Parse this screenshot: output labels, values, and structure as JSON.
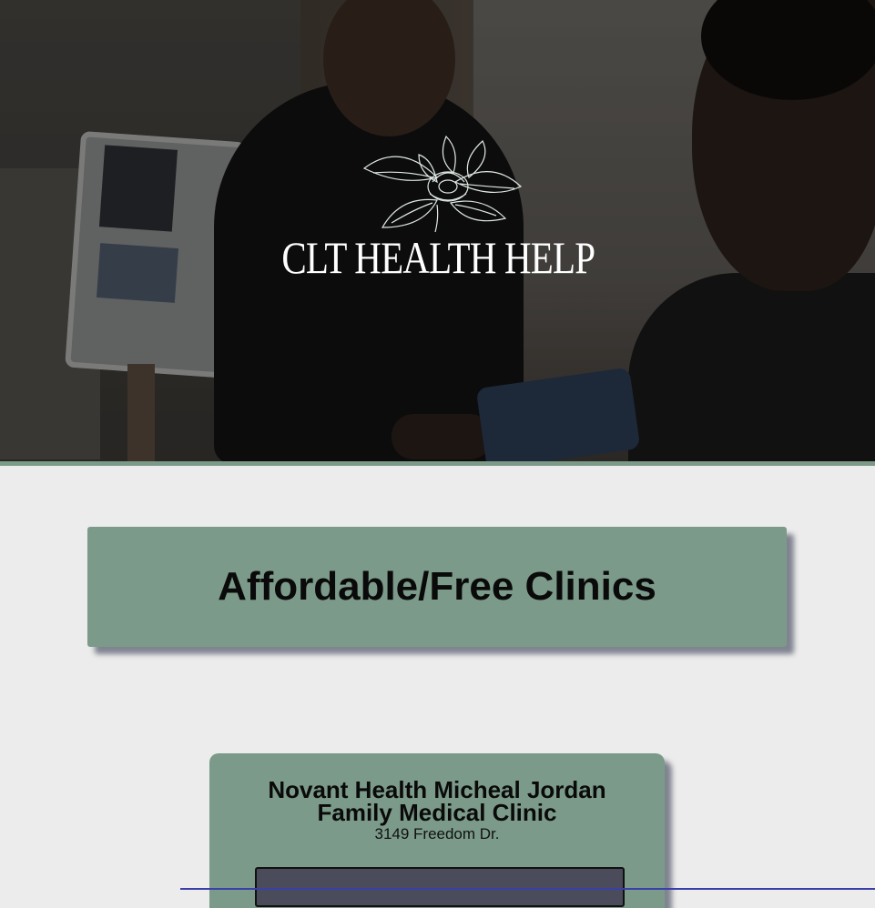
{
  "hero": {
    "brand": "CLT HEALTH HELP",
    "logo_icon": "magnolia-flower-icon"
  },
  "section": {
    "heading": "Affordable/Free Clinics"
  },
  "clinics": [
    {
      "name": "Novant Health Micheal Jordan Family Medical Clinic",
      "address": "3149 Freedom Dr."
    }
  ],
  "colors": {
    "card_green": "#7b9a89",
    "page_bg": "#ececec",
    "accent_line": "#3b3fa8"
  }
}
